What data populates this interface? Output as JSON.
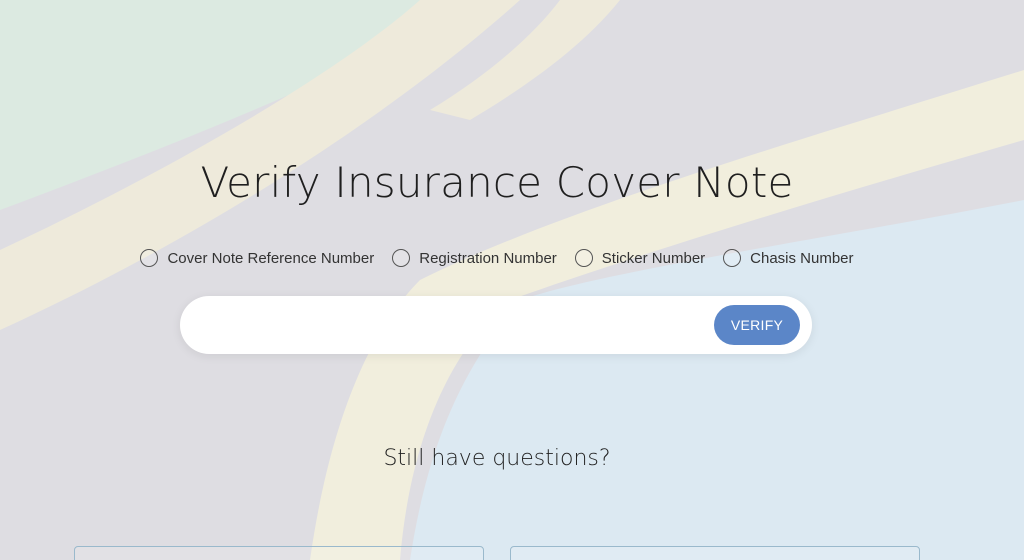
{
  "page": {
    "title": "Verify Insurance Cover Note"
  },
  "options": [
    {
      "label": "Cover Note Reference Number"
    },
    {
      "label": "Registration Number"
    },
    {
      "label": "Sticker Number"
    },
    {
      "label": "Chasis Number"
    }
  ],
  "search": {
    "value": "",
    "button_label": "VERIFY"
  },
  "help": {
    "heading": "Still have questions?"
  },
  "colors": {
    "accent": "#5b86c8",
    "card_border": "#9ab9cc"
  }
}
